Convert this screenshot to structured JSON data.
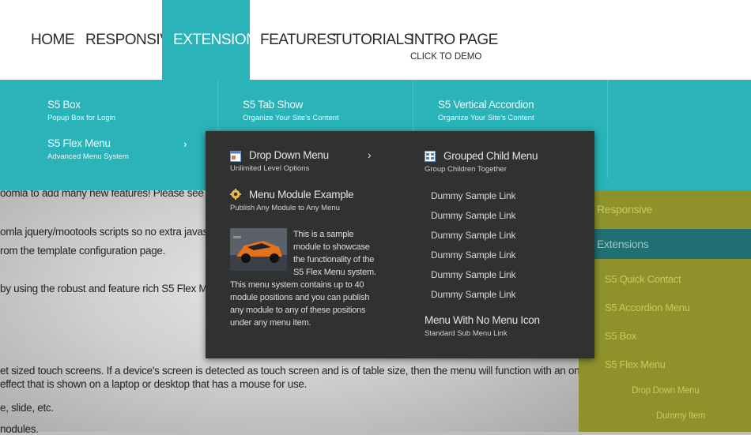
{
  "topnav": {
    "items": [
      {
        "label": "HOME"
      },
      {
        "label": "RESPONSIVE"
      },
      {
        "label": "EXTENSIONS"
      },
      {
        "label": "FEATURES"
      },
      {
        "label": "TUTORIALS"
      },
      {
        "label": "INTRO PAGE",
        "sub": "CLICK TO DEMO"
      }
    ]
  },
  "mega": {
    "items": [
      {
        "title": "S5 Box",
        "subtitle": "Popup Box for Login"
      },
      {
        "title": "S5 Flex Menu",
        "subtitle": "Advanced Menu System"
      },
      {
        "title": "S5 Tab Show",
        "subtitle": "Organize Your Site's Content"
      },
      {
        "title": "S5 Vertical Accordion",
        "subtitle": "Organize Your Site's Content"
      }
    ]
  },
  "dropdown": {
    "drop_down_menu": {
      "title": "Drop Down Menu",
      "subtitle": "Unlimited Level Options"
    },
    "menu_module": {
      "title": "Menu Module Example",
      "subtitle": "Publish Any Module to Any Menu"
    },
    "module_text": [
      "This is a sample",
      "module to showcase",
      "the functionality of the",
      "S5 Flex Menu system.",
      "This menu system contains up to 40",
      "module positions and you can publish",
      "any module to any of these positions",
      "under any menu item."
    ],
    "grouped": {
      "title": "Grouped Child Menu",
      "subtitle": "Group Children Together"
    },
    "links": [
      "Dummy Sample Link",
      "Dummy Sample Link",
      "Dummy Sample Link",
      "Dummy Sample Link",
      "Dummy Sample Link",
      "Dummy Sample Link"
    ],
    "no_icon": {
      "title": "Menu With No Menu Icon",
      "subtitle": "Standard Sub Menu Link"
    }
  },
  "content": {
    "lines": [
      "oomla to add many new features! Please see the fu",
      "omla jquery/mootools scripts so no extra javascript",
      "rom the template configuration page.",
      "by using the robust and feature rich S5 Flex Menu S",
      "et sized touch screens. If a device's screen is detected as touch screen and is of table size, then the menu will function with an onclick",
      " effect that is shown on a laptop or desktop that has a mouse for use.",
      "e, slide, etc.",
      "nodules."
    ]
  },
  "sidebar": {
    "items": [
      "Responsive",
      "Extensions",
      "S5 Quick Contact",
      "S5 Accordion Menu",
      "S5 Box",
      "S5 Flex Menu",
      "Drop Down Menu",
      "Dummy Item"
    ]
  },
  "colors": {
    "teal": "#2ab3b8",
    "dropdown_bg": "#303131",
    "sidebar_olive": "#8f922b"
  }
}
